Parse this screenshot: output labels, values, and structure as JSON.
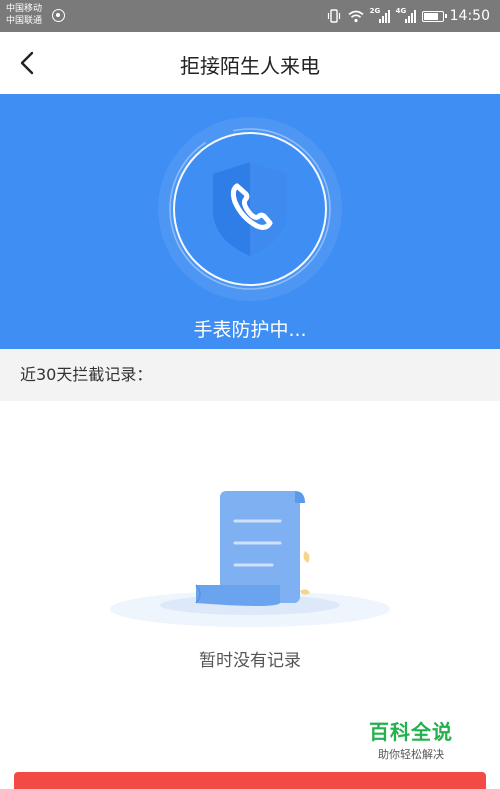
{
  "status_bar": {
    "carrier_1": "中国移动",
    "carrier_2": "中国联通",
    "network_1": "2G",
    "network_2": "4G",
    "time": "14:50"
  },
  "nav": {
    "title": "拒接陌生人来电",
    "back_icon": "chevron-left-icon"
  },
  "hero": {
    "icon": "shield-phone-icon",
    "status_text": "手表防护中..."
  },
  "records": {
    "header": "近30天拦截记录：",
    "empty_icon": "document-scroll-icon",
    "empty_text": "暂时没有记录"
  },
  "watermark": {
    "title": "百科全说",
    "subtitle": "助你轻松解决"
  },
  "colors": {
    "hero_blue": "#3f8ef3",
    "status_bar_gray": "#7a7a7a",
    "section_bg": "#f3f3f3",
    "button_red": "#f24a45",
    "watermark_green": "#22b14c"
  }
}
